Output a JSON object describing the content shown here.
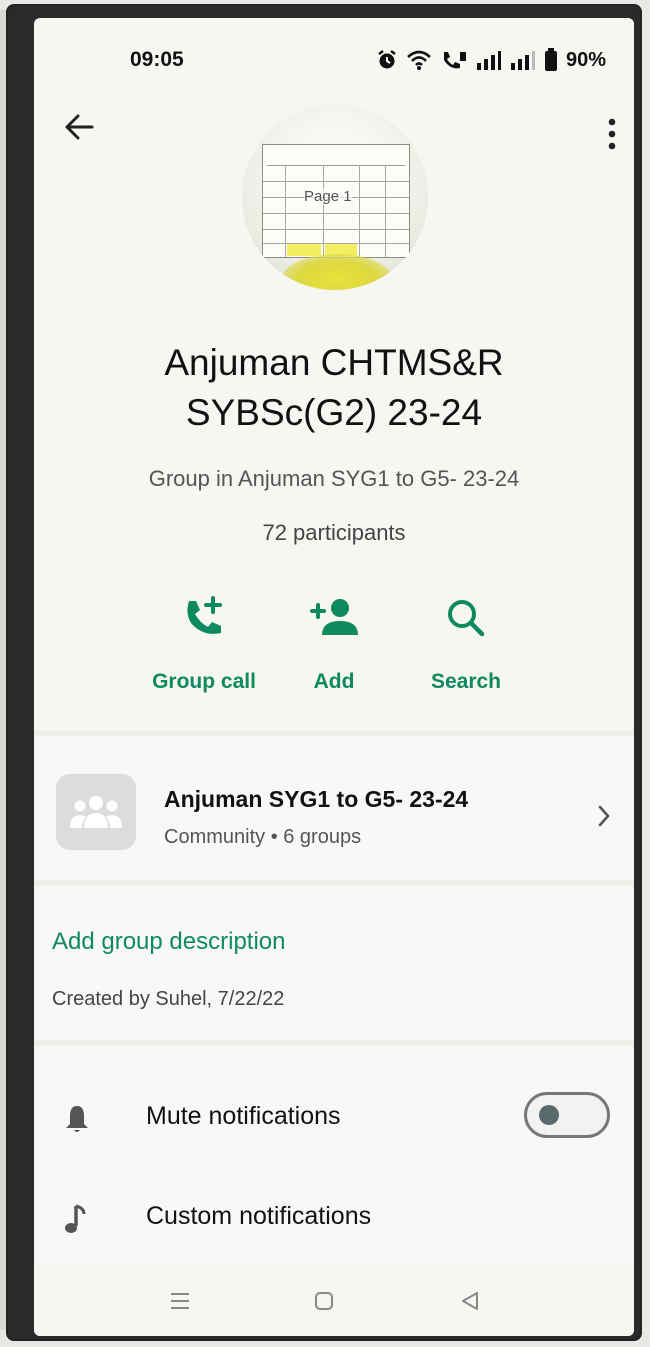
{
  "status": {
    "time": "09:05",
    "battery": "90%"
  },
  "header": {
    "back_icon": "arrow-left-icon",
    "menu_icon": "more-vert-icon"
  },
  "avatar": {
    "image_text": "Page 1"
  },
  "group": {
    "name_line1": "Anjuman CHTMS&R",
    "name_line2": "SYBSc(G2) 23-24",
    "subtitle": "Group in Anjuman SYG1 to G5- 23-24",
    "participants": "72 participants"
  },
  "actions": [
    {
      "label": "Group call",
      "icon": "add-call-icon"
    },
    {
      "label": "Add",
      "icon": "add-person-icon"
    },
    {
      "label": "Search",
      "icon": "search-icon"
    }
  ],
  "community": {
    "title": "Anjuman SYG1 to G5- 23-24",
    "subtitle": "Community • 6 groups",
    "icon": "community-icon"
  },
  "description": {
    "add_label": "Add group description",
    "created": "Created by Suhel, 7/22/22"
  },
  "settings": [
    {
      "label": "Mute notifications",
      "icon": "bell-icon",
      "toggle": false
    },
    {
      "label": "Custom notifications",
      "icon": "music-note-icon"
    }
  ],
  "colors": {
    "accent": "#0f8a5f",
    "background": "#f6f6f3"
  }
}
